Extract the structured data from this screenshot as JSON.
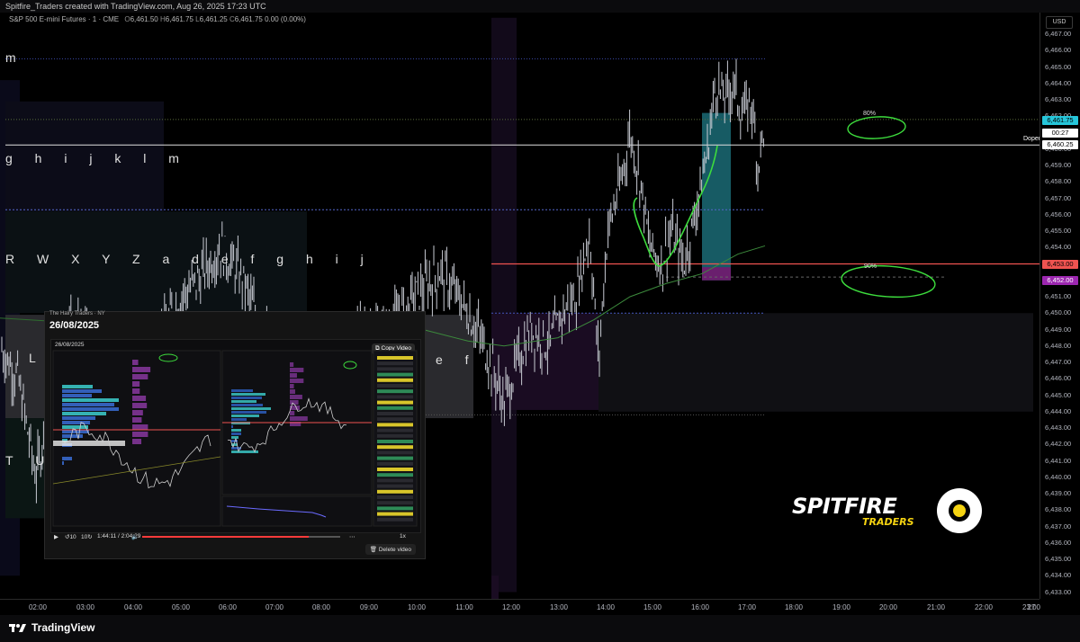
{
  "header": {
    "credit": "Spitfire_Traders created with TradingView.com, Aug 26, 2025 17:23 UTC"
  },
  "legend": {
    "symbol": "S&P 500 E-mini Futures · 1 · CME",
    "o_label": "O",
    "o": "6,461.50",
    "h_label": "H",
    "h": "6,461.75",
    "l_label": "L",
    "l": "6,461.25",
    "c_label": "C",
    "c": "6,461.75",
    "change": "0.00 (0.00%)"
  },
  "price_axis": {
    "currency": "USD",
    "ticks": [
      "6,467.00",
      "6,466.00",
      "6,465.00",
      "6,464.00",
      "6,463.00",
      "6,462.00",
      "6,461.00",
      "6,460.00",
      "6,459.00",
      "6,458.00",
      "6,457.00",
      "6,456.00",
      "6,455.00",
      "6,454.00",
      "6,453.00",
      "6,452.00",
      "6,451.00",
      "6,450.00",
      "6,449.00",
      "6,448.00",
      "6,447.00",
      "6,446.00",
      "6,445.00",
      "6,444.00",
      "6,443.00",
      "6,442.00",
      "6,441.00",
      "6,440.00",
      "6,439.00",
      "6,438.00",
      "6,437.00",
      "6,436.00",
      "6,435.00",
      "6,434.00",
      "6,433.00"
    ],
    "tags": [
      {
        "text": "6,461.75",
        "bg": "#26c6da",
        "fg": "#000000",
        "price": 6461.75
      },
      {
        "text": "00:27",
        "bg": "#ffffff",
        "fg": "#000000",
        "price": 6460.95
      },
      {
        "text": "6,460.25",
        "bg": "#ffffff",
        "fg": "#000000",
        "price": 6460.25
      },
      {
        "text": "6,453.00",
        "bg": "#ef5350",
        "fg": "#000000",
        "price": 6453.0
      },
      {
        "text": "6,452.00",
        "bg": "#9c27b0",
        "fg": "#ffffff",
        "price": 6452.0
      }
    ]
  },
  "time_axis": {
    "ticks": [
      "02:00",
      "03:00",
      "04:00",
      "05:00",
      "06:00",
      "07:00",
      "08:00",
      "09:00",
      "10:00",
      "11:00",
      "12:00",
      "13:00",
      "14:00",
      "15:00",
      "16:00",
      "17:00",
      "18:00",
      "19:00",
      "20:00",
      "21:00",
      "22:00",
      "23:00",
      "27"
    ]
  },
  "letters": {
    "row1": "m",
    "row2": "g h i j k l m",
    "row3": "R W X Y Z a d e f g h i j",
    "row4": "L",
    "row5": "e f",
    "row6": "T U"
  },
  "annotations": {
    "dopen": "Dopen",
    "p80": "80%",
    "p90": "90%"
  },
  "video": {
    "subtitle": "The Hairy Traders · NY",
    "date": "26/08/2025",
    "inner_date": "26/08/2025",
    "copy_label": "Copy Video",
    "time": "1:44:11 / 2:04:29",
    "speed": "1x",
    "progress": 0.84,
    "delete_label": "Delete video"
  },
  "brand": {
    "title": "SPITFIRE",
    "subtitle": "TRADERS",
    "accent": "#f5d311"
  },
  "footer": {
    "logo": "TradingView"
  },
  "colors": {
    "up": "#d1d4dc",
    "cyan": "#26c6da",
    "red": "#ef5350",
    "purple": "#9c27b0",
    "green_line": "#4caf50"
  }
}
